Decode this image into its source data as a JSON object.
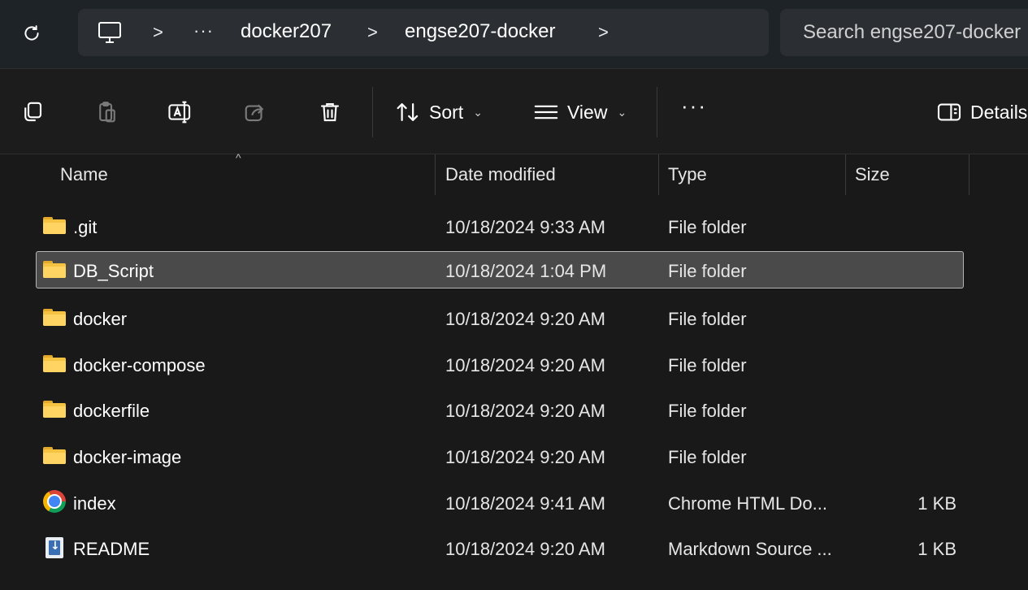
{
  "address_bar": {
    "breadcrumbs": [
      "docker207",
      "engse207-docker"
    ],
    "overflow_label": "···",
    "separator": ">",
    "search_placeholder": "Search engse207-docker"
  },
  "command_bar": {
    "sort_label": "Sort",
    "view_label": "View",
    "more_label": "···",
    "details_label": "Details"
  },
  "columns": {
    "name": "Name",
    "date": "Date modified",
    "type": "Type",
    "size": "Size"
  },
  "files": [
    {
      "name": ".git",
      "date": "10/18/2024 9:33 AM",
      "type": "File folder",
      "size": "",
      "icon": "folder-icon",
      "selected": false
    },
    {
      "name": "DB_Script",
      "date": "10/18/2024 1:04 PM",
      "type": "File folder",
      "size": "",
      "icon": "folder-icon",
      "selected": true
    },
    {
      "name": "docker",
      "date": "10/18/2024 9:20 AM",
      "type": "File folder",
      "size": "",
      "icon": "folder-icon",
      "selected": false
    },
    {
      "name": "docker-compose",
      "date": "10/18/2024 9:20 AM",
      "type": "File folder",
      "size": "",
      "icon": "folder-icon",
      "selected": false
    },
    {
      "name": "dockerfile",
      "date": "10/18/2024 9:20 AM",
      "type": "File folder",
      "size": "",
      "icon": "folder-icon",
      "selected": false
    },
    {
      "name": "docker-image",
      "date": "10/18/2024 9:20 AM",
      "type": "File folder",
      "size": "",
      "icon": "folder-icon",
      "selected": false
    },
    {
      "name": "index",
      "date": "10/18/2024 9:41 AM",
      "type": "Chrome HTML Do...",
      "size": "1 KB",
      "icon": "chrome-icon",
      "selected": false
    },
    {
      "name": "README",
      "date": "10/18/2024 9:20 AM",
      "type": "Markdown Source ...",
      "size": "1 KB",
      "icon": "markdown-file-icon",
      "selected": false
    }
  ],
  "colors": {
    "background": "#191919",
    "address_bar": "#1e2327",
    "selection": "#4a4a4a",
    "folder": "#f5c242"
  }
}
